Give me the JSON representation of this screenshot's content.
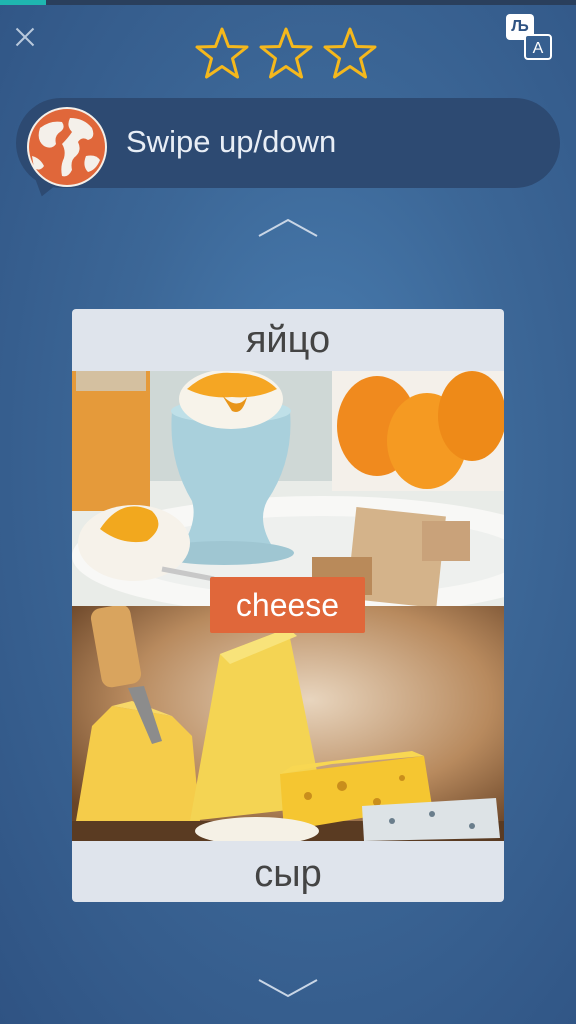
{
  "progress": {
    "fraction": 0.08
  },
  "header": {
    "close_icon": "close-icon",
    "stars_filled": 0,
    "stars_total": 3,
    "star_color": "#f5b81c",
    "translate": {
      "back_glyph": "Љ",
      "front_glyph": "A",
      "icon": "translate-icon"
    }
  },
  "prompt": {
    "icon": "globe-icon",
    "text": "Swipe up/down"
  },
  "card": {
    "top_word": "яйцо",
    "bottom_word": "сыр",
    "answer_label": "cheese",
    "answer_color": "#e0673a",
    "top_image": "egg-photo",
    "bottom_image": "cheese-photo"
  },
  "navigation": {
    "up_icon": "chevron-up-icon",
    "down_icon": "chevron-down-icon"
  }
}
